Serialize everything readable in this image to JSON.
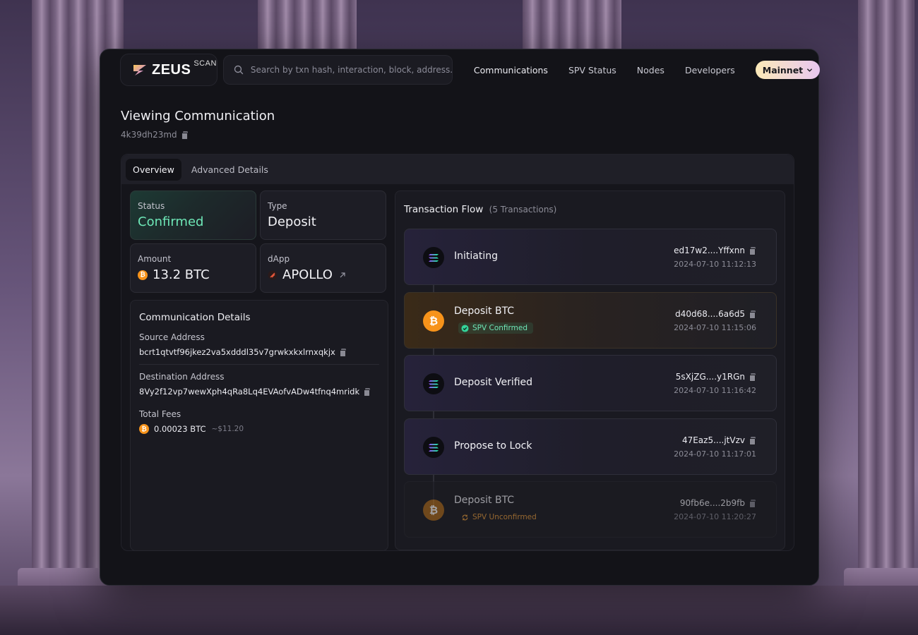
{
  "header": {
    "logo_text": "ZEUS",
    "logo_sup": "SCAN",
    "search_placeholder": "Search by txn hash, interaction, block, address...",
    "nav": [
      "Communications",
      "SPV Status",
      "Nodes",
      "Developers"
    ],
    "network": "Mainnet"
  },
  "page": {
    "title": "Viewing Communication",
    "id": "4k39dh23md"
  },
  "tabs": [
    "Overview",
    "Advanced Details"
  ],
  "summary": {
    "status_label": "Status",
    "status_value": "Confirmed",
    "type_label": "Type",
    "type_value": "Deposit",
    "amount_label": "Amount",
    "amount_value": "13.2 BTC",
    "dapp_label": "dApp",
    "dapp_value": "APOLLO"
  },
  "details": {
    "title": "Communication Details",
    "source_label": "Source Address",
    "source_value": "bcrt1qtvtf96jkez2va5xdddl35v7grwkxkxlrnxqkjx",
    "dest_label": "Destination Address",
    "dest_value": "8Vy2f12vp7wewXph4qRa8Lq4EVAofvADw4tfnq4mridk",
    "fees_label": "Total Fees",
    "fees_value": "0.00023 BTC",
    "fees_usd": "~$11.20"
  },
  "flow": {
    "title": "Transaction Flow",
    "count": "(5 Transactions)",
    "items": [
      {
        "name": "Initiating",
        "hash": "ed17w2....Yffxnn",
        "time": "2024-07-10 11:12:13",
        "chain": "solana",
        "badge": ""
      },
      {
        "name": "Deposit BTC",
        "hash": "d40d68....6a6d5",
        "time": "2024-07-10 11:15:06",
        "chain": "bitcoin",
        "badge": "SPV Confirmed"
      },
      {
        "name": "Deposit Verified",
        "hash": "5sXjZG....y1RGn",
        "time": "2024-07-10 11:16:42",
        "chain": "solana",
        "badge": ""
      },
      {
        "name": "Propose to Lock",
        "hash": "47Eaz5....jtVzv",
        "time": "2024-07-10 11:17:01",
        "chain": "solana",
        "badge": ""
      },
      {
        "name": "Deposit BTC",
        "hash": "90fb6e....2b9fb",
        "time": "2024-07-10 11:20:27",
        "chain": "bitcoin",
        "badge": "SPV Unconfirmed"
      }
    ]
  },
  "colors": {
    "accent_green": "#6ee7b7",
    "bitcoin_orange": "#f7931a",
    "panel_bg": "#131318"
  }
}
